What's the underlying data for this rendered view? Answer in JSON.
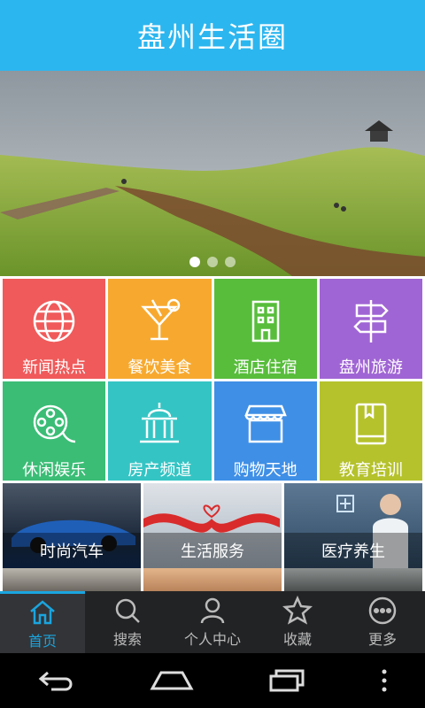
{
  "app": {
    "title": "盘州生活圈"
  },
  "banner": {
    "slide_count": 3,
    "active_index": 0
  },
  "categories": [
    {
      "label": "新闻热点",
      "icon": "globe-icon",
      "color": "#f05a5a"
    },
    {
      "label": "餐饮美食",
      "icon": "cocktail-icon",
      "color": "#f7a92f"
    },
    {
      "label": "酒店住宿",
      "icon": "building-icon",
      "color": "#57bd3b"
    },
    {
      "label": "盘州旅游",
      "icon": "signpost-icon",
      "color": "#a065d4"
    },
    {
      "label": "休闲娱乐",
      "icon": "film-reel-icon",
      "color": "#3bbd76"
    },
    {
      "label": "房产频道",
      "icon": "capitol-icon",
      "color": "#35c4c4"
    },
    {
      "label": "购物天地",
      "icon": "store-icon",
      "color": "#3f8fe6"
    },
    {
      "label": "教育培训",
      "icon": "book-icon",
      "color": "#b5c22c"
    }
  ],
  "promos": [
    {
      "label": "时尚汽车"
    },
    {
      "label": "生活服务"
    },
    {
      "label": "医疗养生"
    }
  ],
  "tabs": [
    {
      "label": "首页",
      "icon": "home-icon",
      "active": true
    },
    {
      "label": "搜索",
      "icon": "search-icon",
      "active": false
    },
    {
      "label": "个人中心",
      "icon": "user-icon",
      "active": false
    },
    {
      "label": "收藏",
      "icon": "star-icon",
      "active": false
    },
    {
      "label": "更多",
      "icon": "more-icon",
      "active": false
    }
  ],
  "system_nav": [
    "back-icon",
    "home-icon",
    "recent-apps-icon",
    "overflow-menu-icon"
  ]
}
